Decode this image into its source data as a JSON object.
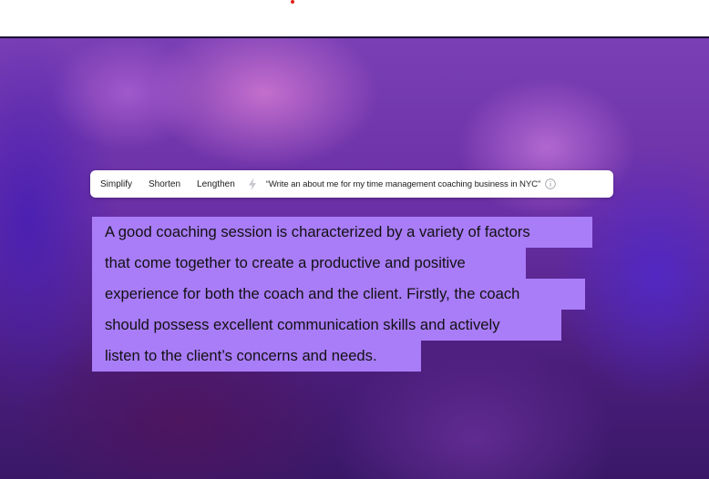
{
  "toolbar": {
    "buttons": [
      "Simplify",
      "Shorten",
      "Lengthen"
    ],
    "prompt": "“Write an about me for my time management coaching business in NYC”"
  },
  "content": {
    "lines": [
      "A good coaching session is characterized by a variety of factors",
      "that come together to create a productive and positive",
      "experience for both the coach and the client. Firstly, the coach",
      "should possess excellent communication skills and actively",
      "listen to the client’s concerns and needs."
    ]
  },
  "colors": {
    "highlight": "#a97cf8",
    "accent_dot": "#e0221b"
  },
  "icons": {
    "separator": "lightning-icon",
    "info": "info-icon"
  }
}
